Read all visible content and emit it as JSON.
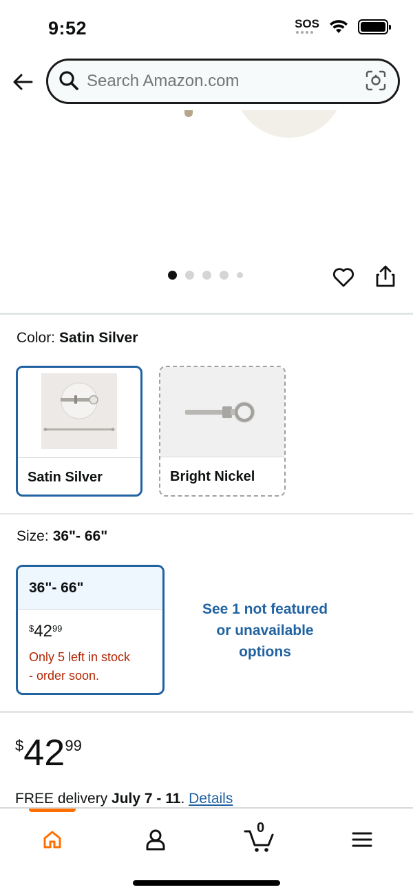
{
  "status_bar": {
    "time": "9:52",
    "sos": "SOS"
  },
  "search": {
    "placeholder": "Search Amazon.com"
  },
  "carousel": {
    "total_images": 5,
    "active_index": 0
  },
  "color": {
    "label": "Color:",
    "selected_value": "Satin Silver",
    "options": [
      {
        "name": "Satin Silver",
        "selected": true
      },
      {
        "name": "Bright Nickel",
        "selected": false
      }
    ]
  },
  "size": {
    "label": "Size:",
    "selected_value": "36\"- 66\"",
    "card": {
      "title": "36\"- 66\"",
      "price_currency": "$",
      "price_whole": "42",
      "price_cents": "99",
      "stock_line1": "Only 5 left in stock",
      "stock_line2": "- order soon."
    },
    "see_more_line1": "See 1 not featured",
    "see_more_line2": "or unavailable",
    "see_more_line3": "options"
  },
  "price": {
    "currency": "$",
    "whole": "42",
    "cents": "99"
  },
  "delivery": {
    "prefix": "FREE delivery",
    "date": "July 7 - 11",
    "sep": ".",
    "details_link": "Details"
  },
  "tab_bar": {
    "cart_count": "0",
    "active_tab": "home"
  },
  "colors": {
    "accent_blue": "#2162a1",
    "stock_red": "#b12704",
    "tab_orange": "#ff6f00"
  }
}
